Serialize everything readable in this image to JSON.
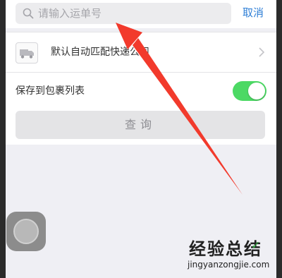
{
  "search": {
    "placeholder": "请输入运单号",
    "cancel_label": "取消"
  },
  "carrier": {
    "label": "默认自动匹配快递公司",
    "icon": "truck-icon"
  },
  "save_toggle": {
    "label": "保存到包裹列表",
    "on": true,
    "color": "#4cd964"
  },
  "query": {
    "label": "查询"
  },
  "watermark": {
    "title": "经验总结",
    "url": "jingyanzongjie.com"
  },
  "colors": {
    "accent": "#2f7fd6",
    "arrow": "#f23a2c",
    "toggle_on": "#4cd964"
  }
}
